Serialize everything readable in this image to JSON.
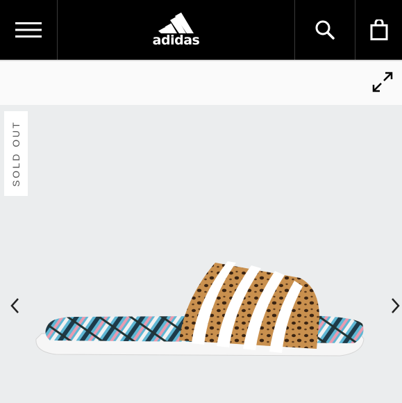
{
  "header": {
    "brand": "adidas",
    "menu_icon": "hamburger-menu-icon",
    "search_icon": "search-icon",
    "bag_icon": "shopping-bag-icon"
  },
  "gallery": {
    "expand_icon": "expand-arrows-icon",
    "badge": "SOLD OUT",
    "prev_icon": "chevron-left-icon",
    "next_icon": "chevron-right-icon"
  },
  "colors": {
    "header_bg": "#000000",
    "stage_bg": "#ebedee",
    "badge_text": "#555555"
  }
}
